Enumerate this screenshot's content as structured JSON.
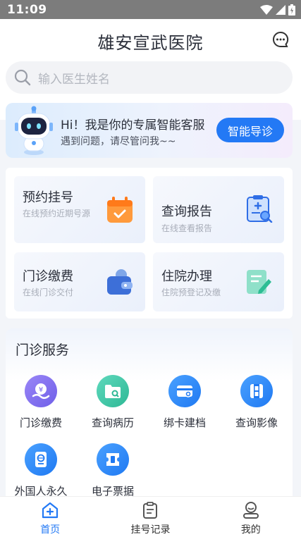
{
  "status_bar": {
    "time": "11:09"
  },
  "header": {
    "title": "雄安宣武医院"
  },
  "search": {
    "placeholder": "输入医生姓名"
  },
  "banner": {
    "title": "Hi！我是你的专属智能客服",
    "subtitle": "遇到问题，请尽管问我~~",
    "button": "智能导诊"
  },
  "quick": [
    {
      "title": "预约挂号",
      "subtitle": "在线预约近期号源",
      "icon": "calendar-icon"
    },
    {
      "title": "查询报告",
      "subtitle": "在线查看报告",
      "icon": "report-icon"
    },
    {
      "title": "门诊缴费",
      "subtitle": "在线门诊交付",
      "icon": "wallet-icon"
    },
    {
      "title": "住院办理",
      "subtitle": "住院预登记及缴",
      "icon": "edit-icon"
    }
  ],
  "services": {
    "title": "门诊服务",
    "items": [
      {
        "label": "门诊缴费",
        "icon": "payment-icon",
        "color": "#7b6ff0"
      },
      {
        "label": "查询病历",
        "icon": "folder-icon",
        "color": "#3cc5a8"
      },
      {
        "label": "绑卡建档",
        "icon": "card-icon",
        "color": "#2f8cf5"
      },
      {
        "label": "查询影像",
        "icon": "film-icon",
        "color": "#2f8cf5"
      },
      {
        "label": "外国人永久",
        "icon": "passport-icon",
        "color": "#2f8cf5"
      },
      {
        "label": "电子票据",
        "icon": "ticket-icon",
        "color": "#2f8cf5"
      }
    ]
  },
  "tabbar": [
    {
      "label": "首页",
      "icon": "home-icon",
      "active": true
    },
    {
      "label": "挂号记录",
      "icon": "clipboard-icon",
      "active": false
    },
    {
      "label": "我的",
      "icon": "profile-icon",
      "active": false
    }
  ],
  "colors": {
    "accent": "#2379f5"
  }
}
